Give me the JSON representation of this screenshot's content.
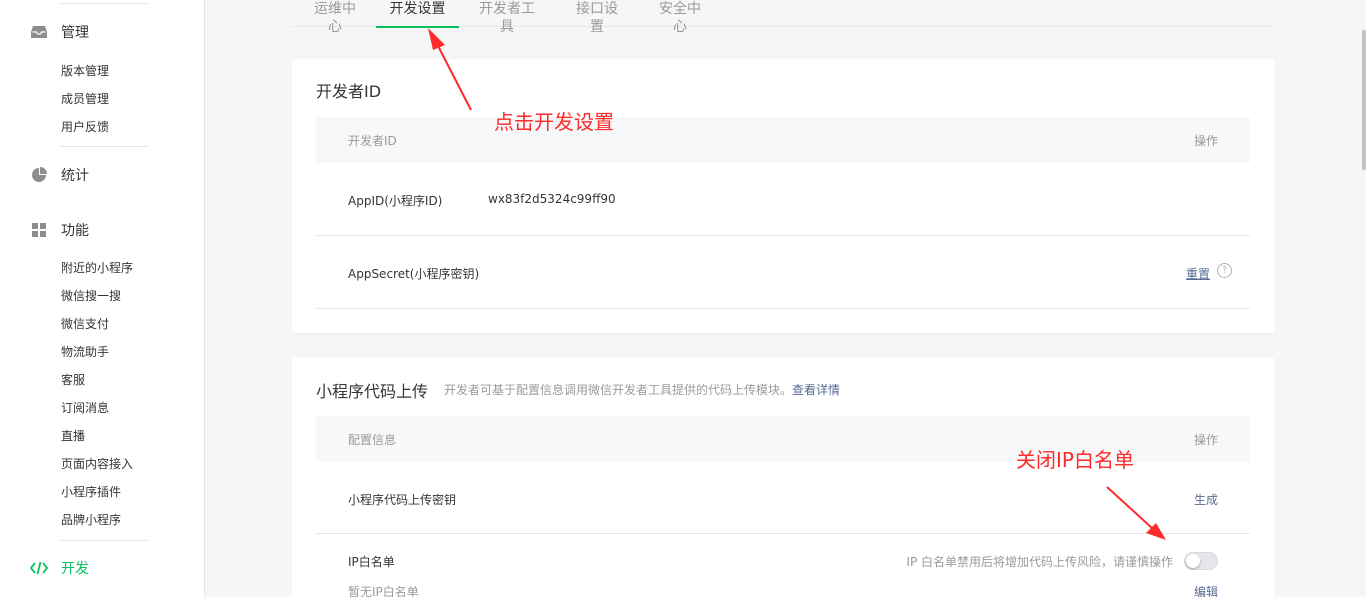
{
  "sidebar": {
    "groups": [
      {
        "label": "管理",
        "icon": "inbox-icon"
      },
      {
        "label": "统计",
        "icon": "pie-chart-icon"
      },
      {
        "label": "功能",
        "icon": "grid-icon"
      },
      {
        "label": "开发",
        "icon": "code-icon"
      }
    ],
    "manage_items": [
      "版本管理",
      "成员管理",
      "用户反馈"
    ],
    "feature_items": [
      "附近的小程序",
      "微信搜一搜",
      "微信支付",
      "物流助手",
      "客服",
      "订阅消息",
      "直播",
      "页面内容接入",
      "小程序插件",
      "品牌小程序"
    ]
  },
  "tabs": [
    "运维中心",
    "开发设置",
    "开发者工具",
    "接口设置",
    "安全中心"
  ],
  "dev_id_card": {
    "title": "开发者ID",
    "head_left": "开发者ID",
    "head_right": "操作",
    "appid_label": "AppID(小程序ID)",
    "appid_value": "wx83f2d5324c99ff90",
    "secret_label": "AppSecret(小程序密钥)",
    "secret_action": "重置"
  },
  "upload_card": {
    "title": "小程序代码上传",
    "desc": "开发者可基于配置信息调用微信开发者工具提供的代码上传模块。",
    "desc_link": "查看详情",
    "head_left": "配置信息",
    "head_right": "操作",
    "key_label": "小程序代码上传密钥",
    "key_action": "生成",
    "ip_label": "IP白名单",
    "ip_warning": "IP 白名单禁用后将增加代码上传风险，请谨慎操作",
    "ip_sub": "暂无IP白名单",
    "ip_action": "编辑"
  },
  "annotations": {
    "a1": "点击开发设置",
    "a2": "关闭IP白名单"
  },
  "colors": {
    "accent": "#07c160",
    "link": "#576b95",
    "annotation": "#ff2a2a"
  }
}
